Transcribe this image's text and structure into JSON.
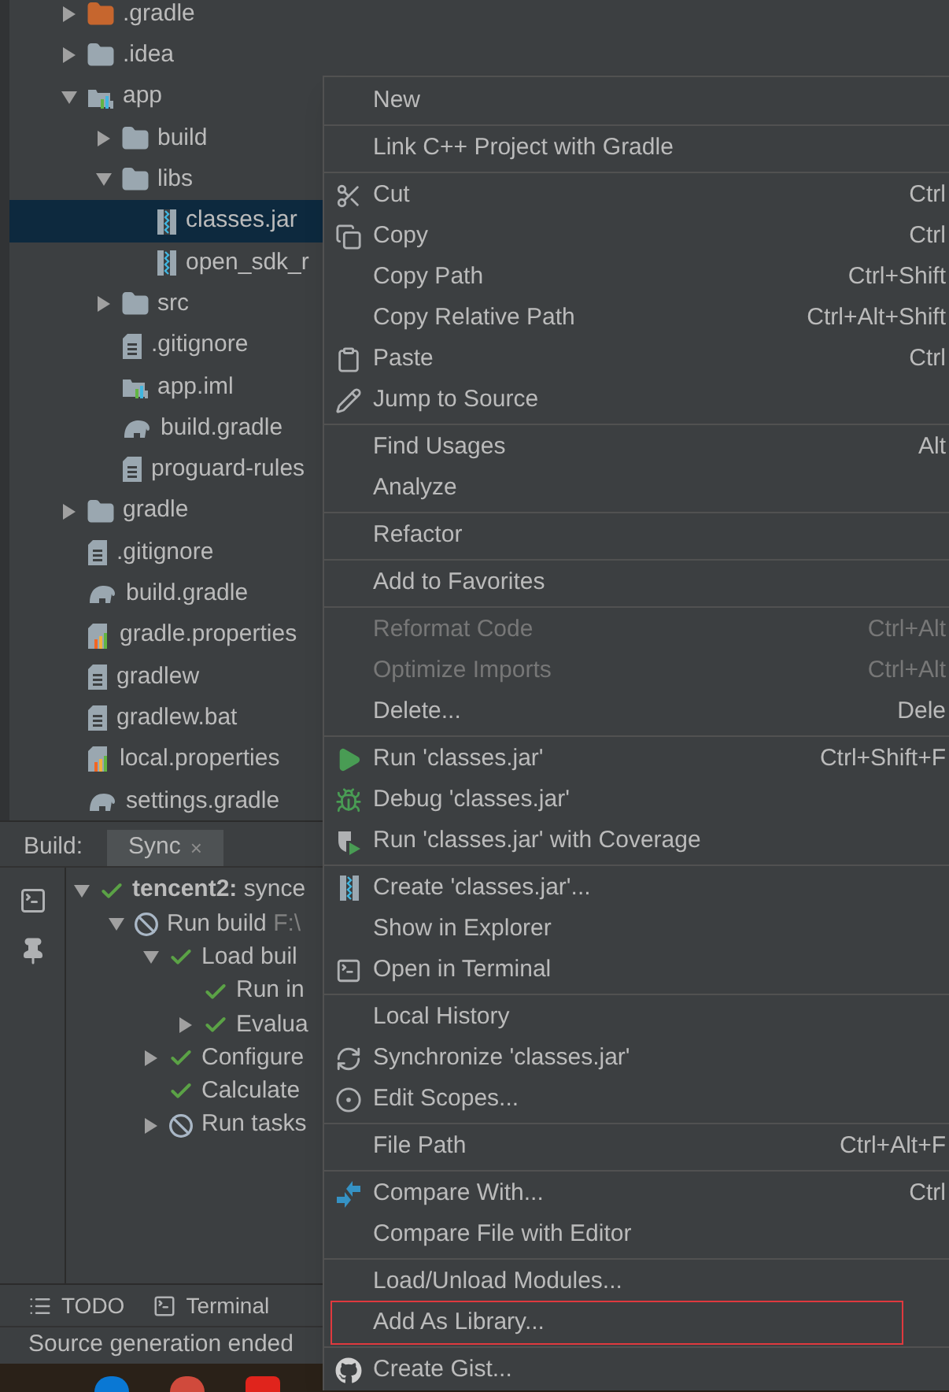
{
  "project_tree": [
    {
      "label": ".gradle",
      "kind": "excluded-folder",
      "expanded": false,
      "selected": false
    },
    {
      "label": ".idea",
      "kind": "folder",
      "expanded": false,
      "selected": false
    },
    {
      "label": "app",
      "kind": "module",
      "expanded": true,
      "selected": false,
      "children": [
        {
          "label": "build",
          "kind": "folder",
          "expanded": false,
          "selected": false
        },
        {
          "label": "libs",
          "kind": "folder",
          "expanded": true,
          "selected": false,
          "children": [
            {
              "label": "classes.jar",
              "kind": "jar",
              "selected": true
            },
            {
              "label": "open_sdk_r",
              "kind": "jar",
              "selected": false
            }
          ]
        },
        {
          "label": "src",
          "kind": "folder",
          "expanded": false,
          "selected": false
        },
        {
          "label": ".gitignore",
          "kind": "file",
          "selected": false
        },
        {
          "label": "app.iml",
          "kind": "module",
          "selected": false
        },
        {
          "label": "build.gradle",
          "kind": "gradle",
          "selected": false
        },
        {
          "label": "proguard-rules",
          "kind": "file",
          "selected": false
        }
      ]
    },
    {
      "label": "gradle",
      "kind": "folder",
      "expanded": false,
      "selected": false
    },
    {
      "label": ".gitignore",
      "kind": "file",
      "selected": false
    },
    {
      "label": "build.gradle",
      "kind": "gradle",
      "selected": false
    },
    {
      "label": "gradle.properties",
      "kind": "properties",
      "selected": false
    },
    {
      "label": "gradlew",
      "kind": "file",
      "selected": false
    },
    {
      "label": "gradlew.bat",
      "kind": "file",
      "selected": false
    },
    {
      "label": "local.properties",
      "kind": "properties",
      "selected": false
    },
    {
      "label": "settings.gradle",
      "kind": "gradle",
      "selected": false
    }
  ],
  "build_panel": {
    "title": "Build:",
    "tabs": [
      {
        "label": "Sync",
        "close": "×",
        "selected": true
      }
    ],
    "tree": [
      {
        "label": "**tencent2:** synce",
        "kind": "success",
        "expanded": true,
        "children": [
          {
            "label": "Run build",
            "detail": "F:\\",
            "kind": "cancelled",
            "expanded": true,
            "children": [
              {
                "label": "Load buil",
                "kind": "success",
                "expanded": true,
                "children": [
                  {
                    "label": "Run in",
                    "kind": "success"
                  },
                  {
                    "label": "Evalua",
                    "kind": "success",
                    "expanded": false
                  }
                ]
              },
              {
                "label": "Configure",
                "kind": "success",
                "expanded": false
              },
              {
                "label": "Calculate",
                "kind": "success"
              },
              {
                "label": "Run tasks",
                "kind": "cancelled",
                "expanded": false
              }
            ]
          }
        ]
      }
    ]
  },
  "tool_window_bar": [
    {
      "label": "TODO",
      "kind": "list"
    },
    {
      "label": "Terminal",
      "kind": "terminal"
    }
  ],
  "status_bar": {
    "text": "Source generation ended"
  },
  "context_menu": {
    "groups": [
      [
        {
          "label": "New"
        }
      ],
      [
        {
          "label": "Link C++ Project with Gradle"
        }
      ],
      [
        {
          "label": "Cut",
          "kind": "scissors",
          "shortcut": "Ctrl"
        },
        {
          "label": "Copy",
          "kind": "copy",
          "shortcut": "Ctrl"
        },
        {
          "label": "Copy Path",
          "shortcut": "Ctrl+Shift"
        },
        {
          "label": "Copy Relative Path",
          "shortcut": "Ctrl+Alt+Shift"
        },
        {
          "label": "Paste",
          "kind": "clipboard",
          "shortcut": "Ctrl"
        },
        {
          "label": "Jump to Source",
          "kind": "pencil"
        }
      ],
      [
        {
          "label": "Find Usages",
          "shortcut": "Alt"
        },
        {
          "label": "Analyze"
        }
      ],
      [
        {
          "label": "Refactor"
        }
      ],
      [
        {
          "label": "Add to Favorites"
        }
      ],
      [
        {
          "label": "Reformat Code",
          "shortcut": "Ctrl+Alt",
          "disabled": true
        },
        {
          "label": "Optimize Imports",
          "shortcut": "Ctrl+Alt",
          "disabled": true
        },
        {
          "label": "Delete...",
          "shortcut": "Dele",
          "disabled": false
        }
      ],
      [
        {
          "label": "Run 'classes.jar'",
          "kind": "run",
          "shortcut": "Ctrl+Shift+F"
        },
        {
          "label": "Debug 'classes.jar'",
          "kind": "bug"
        },
        {
          "label": "Run 'classes.jar' with Coverage",
          "kind": "coverage"
        }
      ],
      [
        {
          "label": "Create 'classes.jar'...",
          "kind": "jar"
        },
        {
          "label": "Show in Explorer"
        },
        {
          "label": "Open in Terminal",
          "kind": "terminal"
        }
      ],
      [
        {
          "label": "Local History"
        },
        {
          "label": "Synchronize 'classes.jar'",
          "kind": "sync"
        },
        {
          "label": "Edit Scopes...",
          "kind": "scope"
        }
      ],
      [
        {
          "label": "File Path",
          "shortcut": "Ctrl+Alt+F"
        }
      ],
      [
        {
          "label": "Compare With...",
          "kind": "compare",
          "shortcut": "Ctrl"
        },
        {
          "label": "Compare File with Editor"
        }
      ],
      [
        {
          "label": "Load/Unload Modules...",
          "outlined": false
        },
        {
          "label": "Add As Library...",
          "outlined": true
        }
      ],
      [
        {
          "label": "Create Gist...",
          "kind": "github"
        }
      ]
    ]
  }
}
